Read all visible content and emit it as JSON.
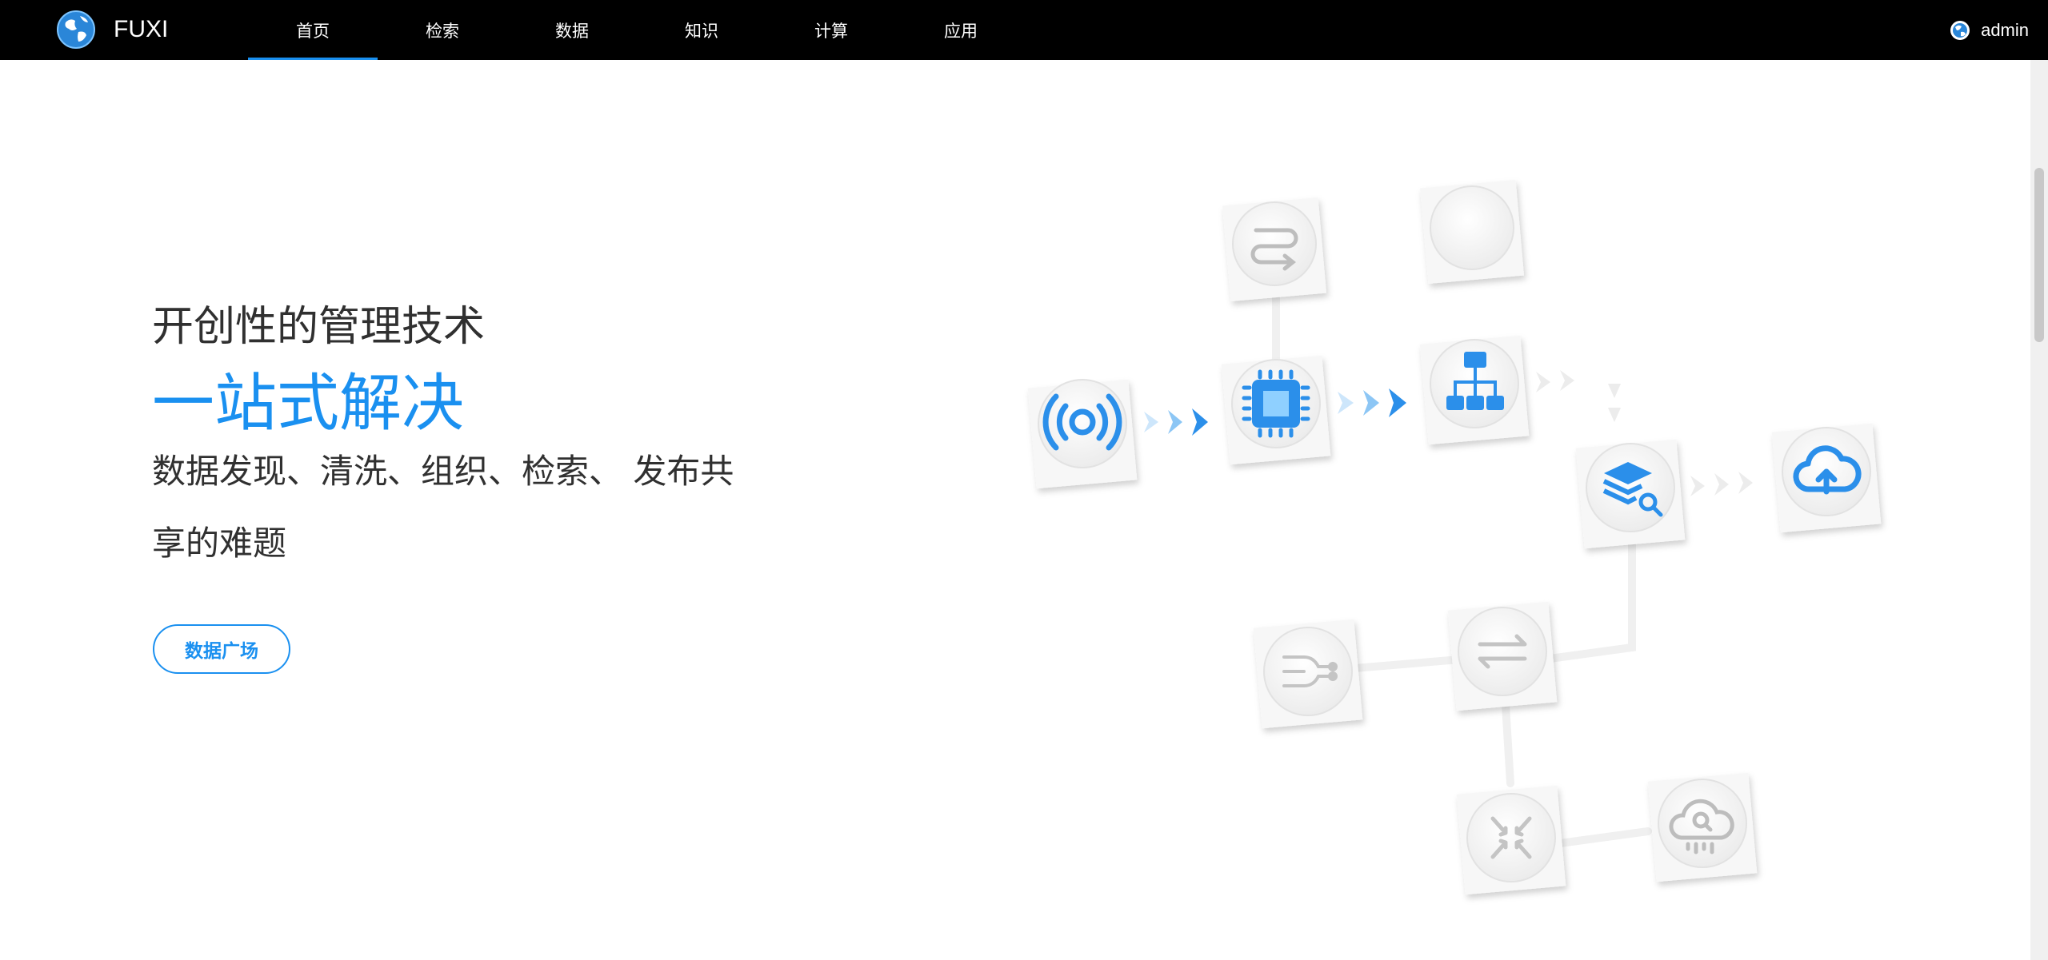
{
  "header": {
    "brand": "FUXI",
    "nav": [
      {
        "label": "首页",
        "active": true
      },
      {
        "label": "检索",
        "active": false
      },
      {
        "label": "数据",
        "active": false
      },
      {
        "label": "知识",
        "active": false
      },
      {
        "label": "计算",
        "active": false
      },
      {
        "label": "应用",
        "active": false
      }
    ],
    "user": "admin"
  },
  "hero": {
    "line1": "开创性的管理技术",
    "line2": "一站式解决",
    "line3": "数据发现、清洗、组织、检索、 发布共享的难题",
    "cta": "数据广场"
  },
  "illustration": {
    "accent_color": "#1a90f0",
    "nodes": [
      "signal-icon",
      "chip-icon",
      "hierarchy-icon",
      "layers-search-icon",
      "cloud-upload-icon",
      "swap-icon",
      "blank-icon",
      "merge-lines-icon",
      "transfer-icon",
      "collapse-icon",
      "cloud-search-icon"
    ]
  }
}
